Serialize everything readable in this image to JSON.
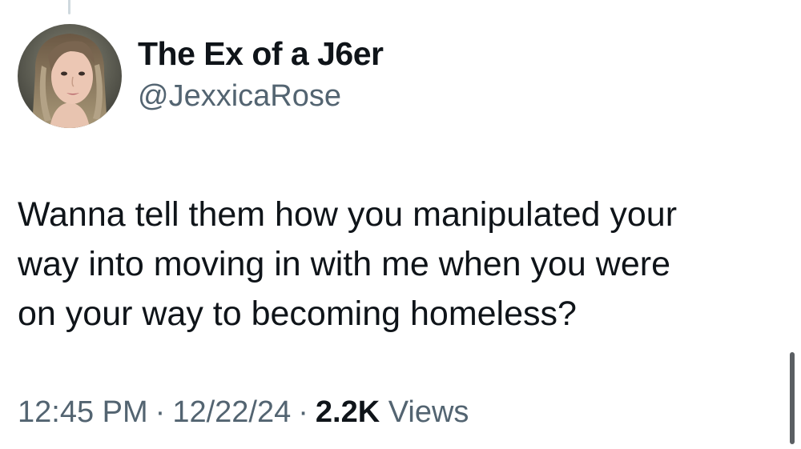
{
  "author": {
    "display_name": "The Ex of a J6er",
    "handle": "@JexxicaRose",
    "avatar_icon": "profile-photo"
  },
  "tweet": {
    "lines": [
      "Wanna tell them how you manipulated your",
      "way into moving in with me when you were",
      "on your way to becoming homeless?"
    ]
  },
  "meta": {
    "time": "12:45 PM",
    "separator": "·",
    "date": "12/22/24",
    "views_count": "2.2K",
    "views_label": "Views"
  },
  "colors": {
    "primary_text": "#0f1419",
    "secondary_text": "#536471",
    "background": "#ffffff"
  }
}
